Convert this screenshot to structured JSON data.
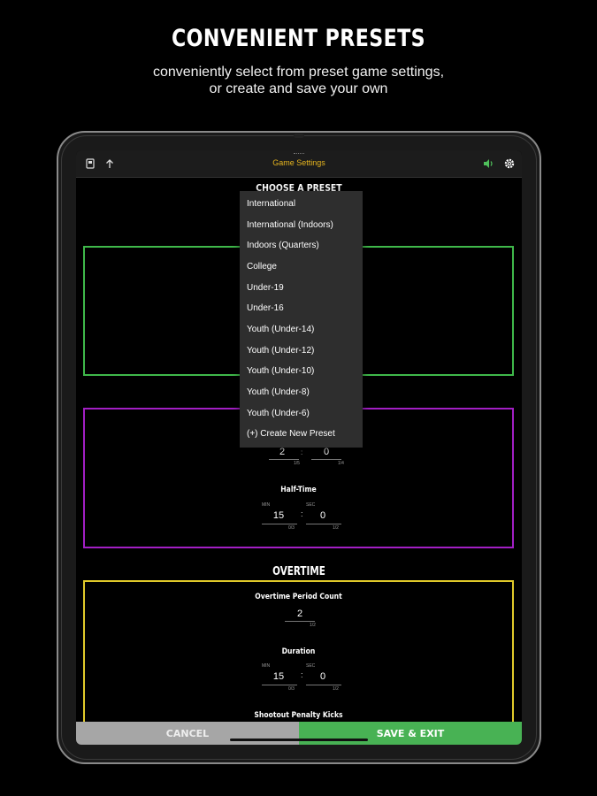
{
  "promo": {
    "headline": "CONVENIENT PRESETS",
    "subline_1": "conveniently select from preset game settings,",
    "subline_2": "or create and save your own"
  },
  "nav": {
    "title": "Game Settings",
    "left_icons": [
      "device-icon",
      "upload-icon"
    ],
    "right_icons": [
      "volume-icon",
      "gear-icon"
    ]
  },
  "choose_preset": {
    "label": "CHOOSE A PRESET",
    "options": [
      "International",
      "International (Indoors)",
      "Indoors (Quarters)",
      "College",
      "Under-19",
      "Under-16",
      "Youth (Under-14)",
      "Youth (Under-12)",
      "Youth (Under-10)",
      "Youth (Under-8)",
      "Youth (Under-6)",
      "(+) Create New Preset"
    ]
  },
  "periods": {
    "count_value": "2",
    "count_hint": "1/5",
    "other_value": "0",
    "other_hint": "1/4"
  },
  "half_time": {
    "label": "Half-Time",
    "min_label": "MIN",
    "min_value": "15",
    "min_hint": "0/3",
    "sep": ":",
    "sec_label": "SEC",
    "sec_value": "0",
    "sec_hint": "1/2"
  },
  "overtime": {
    "title": "OVERTIME",
    "period_count_label": "Overtime Period Count",
    "period_count_value": "2",
    "period_count_hint": "1/2",
    "duration_label": "Duration",
    "min_label": "MIN",
    "min_value": "15",
    "min_hint": "0/3",
    "sep": ":",
    "sec_label": "SEC",
    "sec_value": "0",
    "sec_hint": "1/2",
    "shootout_label": "Shootout Penalty Kicks"
  },
  "actions": {
    "cancel_label": "CANCEL",
    "save_label": "SAVE & EXIT"
  },
  "colors": {
    "green_border": "#3fb84a",
    "purple_border": "#a21fc4",
    "yellow_border": "#e0c92a",
    "nav_title": "#e6b51f",
    "save_button": "#48b254",
    "cancel_button": "#a6a6a6"
  }
}
